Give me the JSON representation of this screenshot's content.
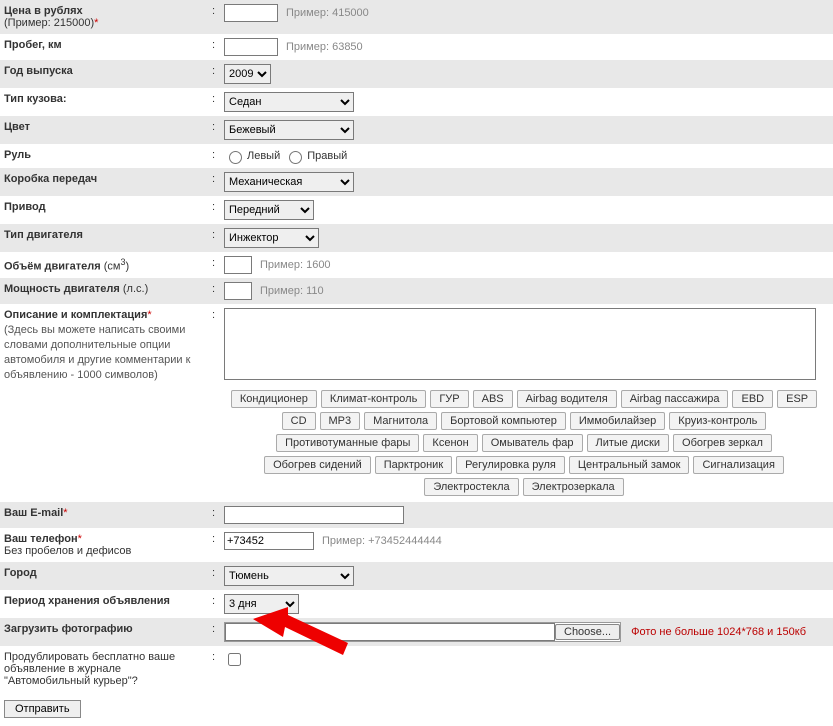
{
  "rows": {
    "price": {
      "label": "Цена в рублях",
      "sublabel": "(Пример: 215000)",
      "hint": "Пример: 415000"
    },
    "mileage": {
      "label": "Пробег, км",
      "hint": "Пример: 63850"
    },
    "year": {
      "label": "Год выпуска",
      "value": "2009"
    },
    "body": {
      "label": "Тип кузова:",
      "value": "Седан"
    },
    "color": {
      "label": "Цвет",
      "value": "Бежевый"
    },
    "steering": {
      "label": "Руль",
      "left": "Левый",
      "right": "Правый"
    },
    "gearbox": {
      "label": "Коробка передач",
      "value": "Механическая"
    },
    "drive": {
      "label": "Привод",
      "value": "Передний"
    },
    "engine_type": {
      "label": "Тип двигателя",
      "value": "Инжектор"
    },
    "engine_vol": {
      "label": "Объём двигателя",
      "unit_prefix": "(см",
      "unit_suffix": ")",
      "hint": "Пример: 1600"
    },
    "power": {
      "label": "Мощность двигателя",
      "unit": "(л.с.)",
      "hint": "Пример: 110"
    },
    "desc": {
      "label": "Описание и комплектация",
      "hint": "(Здесь вы можете написать своими словами дополнительные опции автомобиля и другие комментарии к объявлению - 1000 символов)"
    },
    "email": {
      "label": "Ваш E-mail"
    },
    "phone": {
      "label": "Ваш телефон",
      "sub": "Без пробелов и дефисов",
      "value": "+73452",
      "hint": "Пример: +73452444444"
    },
    "city": {
      "label": "Город",
      "value": "Тюмень"
    },
    "period": {
      "label": "Период хранения объявления",
      "value": "3 дня"
    },
    "upload": {
      "label": "Загрузить фотографию",
      "btn": "Choose...",
      "note": "Фото не больше 1024*768 и 150кб"
    },
    "dup": {
      "label": "Продублировать бесплатно ваше объявление в журнале \"Автомобильный курьер\"?"
    }
  },
  "options": [
    "Кондиционер",
    "Климат-контроль",
    "ГУР",
    "ABS",
    "Airbag водителя",
    "Airbag пассажира",
    "EBD",
    "ESP",
    "CD",
    "MP3",
    "Магнитола",
    "Бортовой компьютер",
    "Иммобилайзер",
    "Круиз-контроль",
    "Противотуманные фары",
    "Ксенон",
    "Омыватель фар",
    "Литые диски",
    "Обогрев зеркал",
    "Обогрев сидений",
    "Парктроник",
    "Регулировка руля",
    "Центральный замок",
    "Сигнализация",
    "Электростекла",
    "Электрозеркала"
  ],
  "submit": "Отправить",
  "colors": {
    "required": "#c00",
    "note": "#b00"
  }
}
